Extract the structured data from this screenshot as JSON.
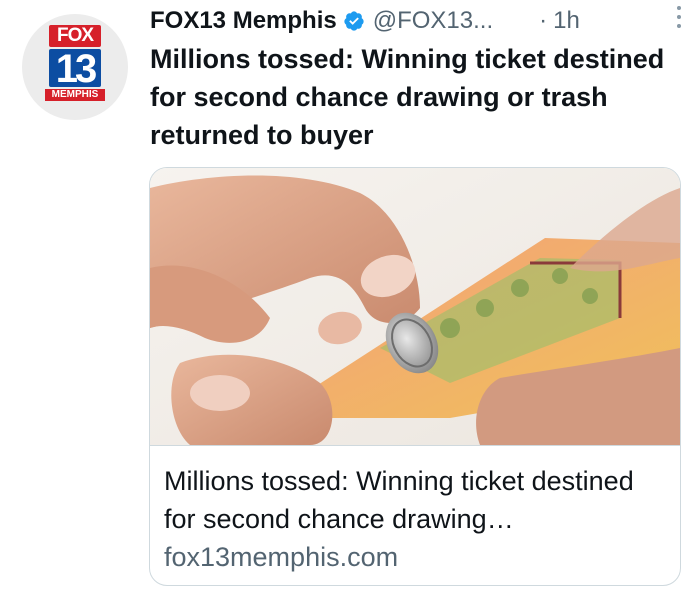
{
  "account": {
    "name": "FOX13 Memphis",
    "handle": "@FOX13...",
    "dot": "·",
    "time": "1h",
    "verified": true,
    "avatar": {
      "logo_top": "FOX",
      "logo_number": "13",
      "logo_bottom": "MEMPHIS",
      "colors": {
        "red": "#d6202a",
        "blue": "#0c4da2"
      }
    }
  },
  "tweet": {
    "text": "Millions tossed: Winning ticket destined for second chance drawing or trash returned to buyer"
  },
  "link_card": {
    "image_icon": "lottery-ticket-scratch-photo",
    "title": "Millions tossed: Winning ticket destined for second chance drawing…",
    "domain": "fox13memphis.com"
  },
  "colors": {
    "text_primary": "#0f1419",
    "text_secondary": "#536471",
    "verified_blue": "#1d9bf0",
    "border": "#cfd9de"
  }
}
